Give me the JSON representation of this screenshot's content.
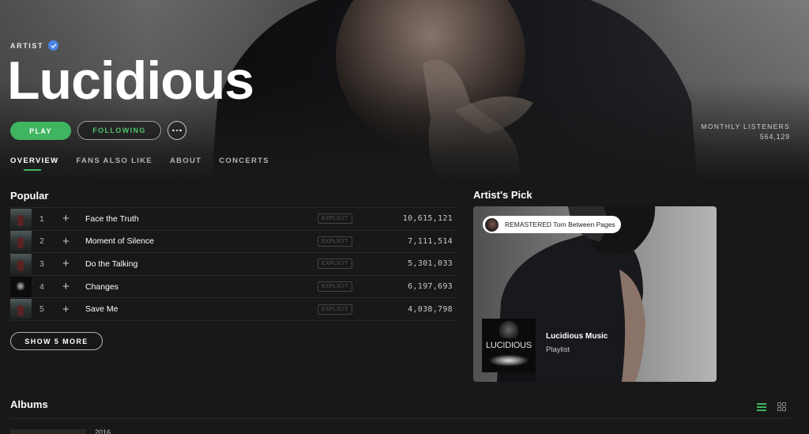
{
  "hero": {
    "type_label": "ARTIST",
    "verified": true,
    "artist_name": "Lucidious",
    "play_label": "PLAY",
    "follow_label": "FOLLOWING",
    "more_label": "More options",
    "monthly_listeners_label": "MONTHLY LISTENERS",
    "monthly_listeners_value": "564,129"
  },
  "tabs": [
    {
      "label": "OVERVIEW",
      "active": true
    },
    {
      "label": "FANS ALSO LIKE",
      "active": false
    },
    {
      "label": "ABOUT",
      "active": false
    },
    {
      "label": "CONCERTS",
      "active": false
    }
  ],
  "popular": {
    "title": "Popular",
    "tracks": [
      {
        "num": "1",
        "title": "Face the Truth",
        "explicit": "EXPLICIT",
        "plays": "10,615,121"
      },
      {
        "num": "2",
        "title": "Moment of Silence",
        "explicit": "EXPLICIT",
        "plays": "7,111,514"
      },
      {
        "num": "3",
        "title": "Do the Talking",
        "explicit": "EXPLICIT",
        "plays": "5,301,033"
      },
      {
        "num": "4",
        "title": "Changes",
        "explicit": "EXPLICIT",
        "plays": "6,197,693"
      },
      {
        "num": "5",
        "title": "Save Me",
        "explicit": "EXPLICIT",
        "plays": "4,038,798"
      }
    ],
    "show_more_label": "SHOW 5 MORE"
  },
  "artists_pick": {
    "title": "Artist's Pick",
    "badge_text": "REMASTERED Torn Between Pages",
    "cover_text": "LUCIDIOUS",
    "item_name": "Lucidious Music",
    "item_type": "Playlist"
  },
  "albums": {
    "title": "Albums",
    "first_year": "2016",
    "view_modes": [
      "list-view",
      "grid-view"
    ],
    "active_view": "list-view"
  },
  "colors": {
    "accent_green": "#3fb561",
    "background": "#181818",
    "verified_blue": "#4a86e8"
  }
}
